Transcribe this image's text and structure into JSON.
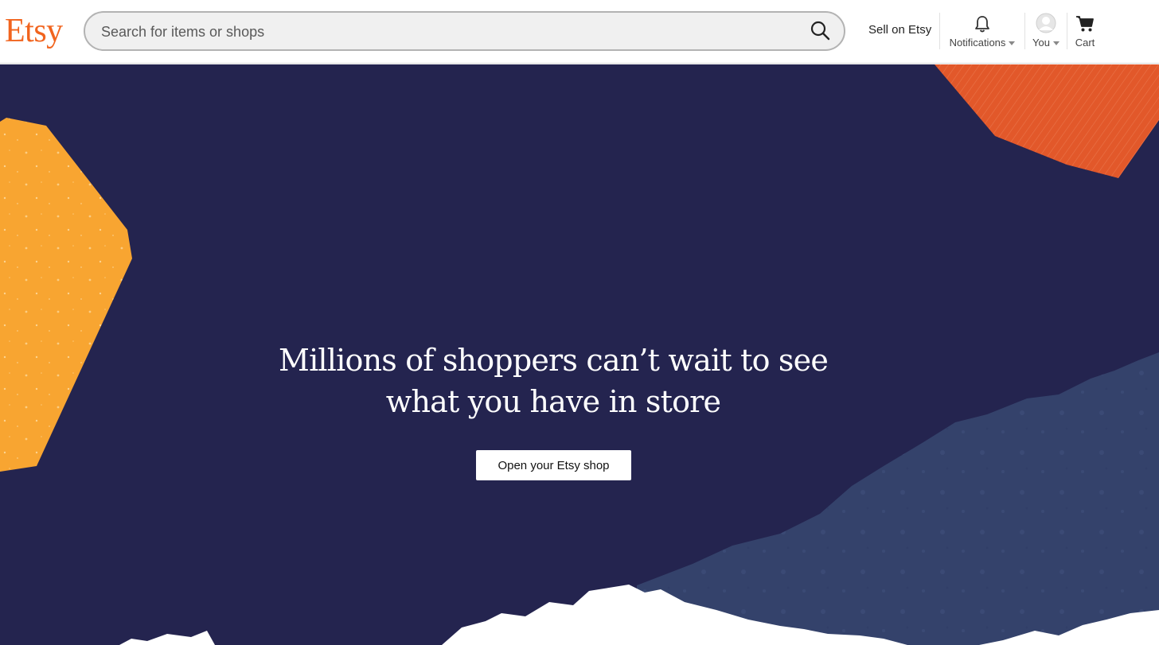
{
  "header": {
    "logo": "Etsy",
    "search": {
      "placeholder": "Search for items or shops",
      "icon": "search-icon"
    },
    "sell_label": "Sell on Etsy",
    "nav": [
      {
        "label": "Notifications",
        "icon": "bell-icon"
      },
      {
        "label": "You",
        "icon": "avatar"
      },
      {
        "label": "Cart",
        "icon": "cart-icon"
      }
    ]
  },
  "hero": {
    "headline_line1": "Millions of shoppers can’t wait to see",
    "headline_line2": "what you have in store",
    "cta_label": "Open your Etsy shop"
  },
  "colors": {
    "brand": "#f1641e",
    "hero_background": "#24244f",
    "shape_yellow": "#f8a531",
    "shape_orange": "#e2582a",
    "shape_blue": "#34426b"
  }
}
